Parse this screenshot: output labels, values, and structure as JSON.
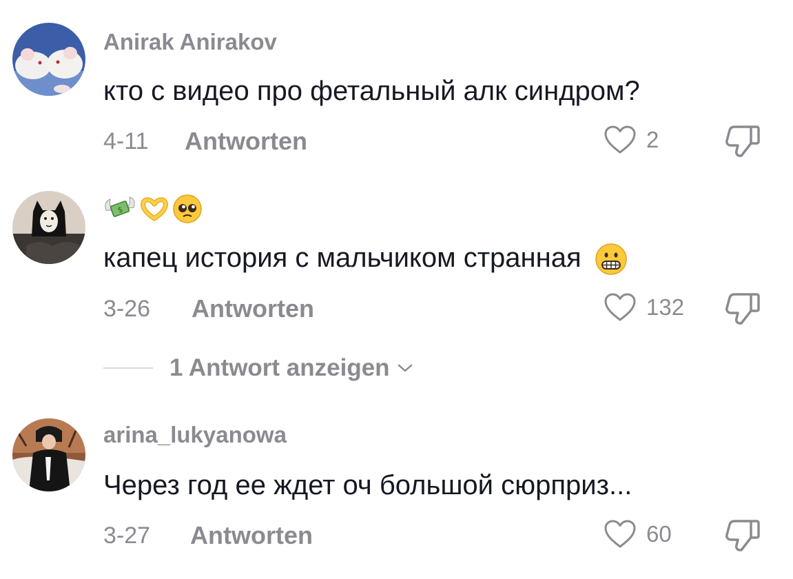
{
  "comments": [
    {
      "avatar_icon": "rats-avatar",
      "username": "Anirak Anirakov",
      "text": "кто с видео про фетальный алк синдром?",
      "date": "4-11",
      "reply_label": "Antworten",
      "likes": "2"
    },
    {
      "avatar_icon": "cat-avatar",
      "username_emoji": [
        "money-with-wings-emoji",
        "heart-hands-emoji",
        "pleading-face-emoji"
      ],
      "text": "капец история с мальчиком странная",
      "text_emoji": "grimacing-face-emoji",
      "date": "3-26",
      "reply_label": "Antworten",
      "likes": "132",
      "view_replies": "1 Antwort anzeigen"
    },
    {
      "avatar_icon": "winter-person-avatar",
      "username": "arina_lukyanowa",
      "text": "Через год ее ждет оч большой сюрприз...",
      "date": "3-27",
      "reply_label": "Antworten",
      "likes": "60"
    }
  ],
  "colors": {
    "text": "#161823",
    "muted": "#8a8b91",
    "divider": "#d8d9dc"
  }
}
